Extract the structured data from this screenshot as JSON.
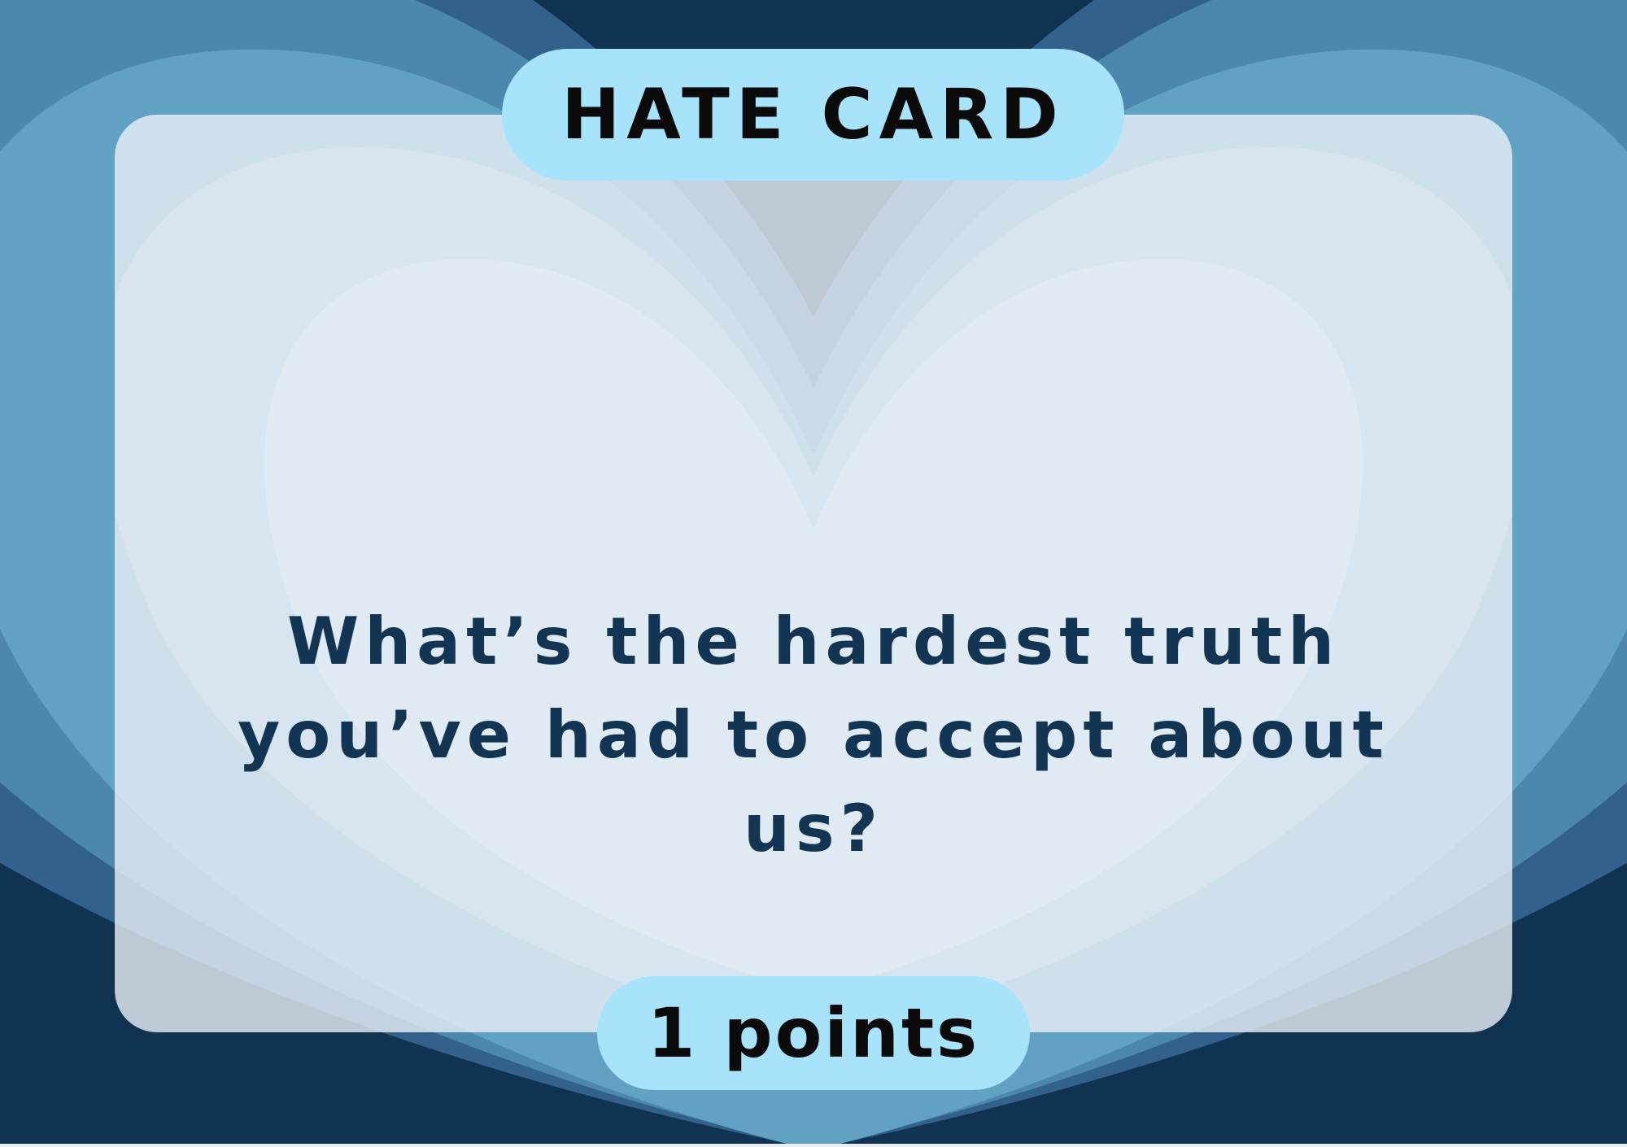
{
  "card": {
    "title": "HATE CARD",
    "question_line1": "What’s the hardest truth",
    "question_line2": "you’ve had to accept about us?",
    "points_label": "1 points"
  },
  "colors": {
    "background_dark": "#0f3350",
    "heart_outer": "#32628c",
    "heart_mid": "#4c88ab",
    "heart_inner": "#61a2c3",
    "card_panel": "#e8f0f6",
    "pill": "#a7e3fb",
    "question_text": "#123553",
    "pill_text": "#0b0b0b"
  },
  "icons": [
    "heart-shape-background"
  ]
}
